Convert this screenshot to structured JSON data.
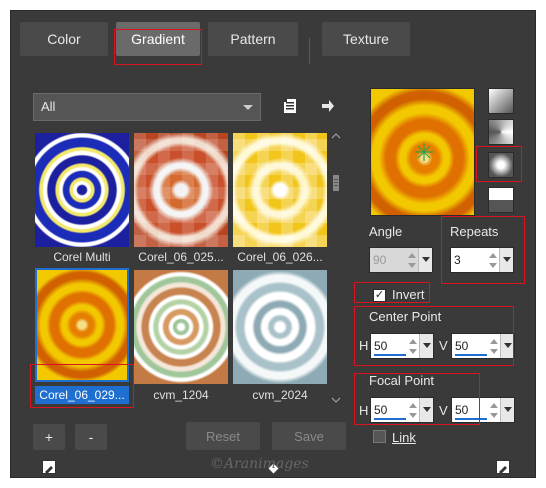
{
  "tabs": [
    {
      "label": "Color",
      "active": false
    },
    {
      "label": "Gradient",
      "active": true
    },
    {
      "label": "Pattern",
      "active": false
    },
    {
      "label": "Texture",
      "active": false
    }
  ],
  "category_dropdown": {
    "value": "All"
  },
  "thumbnails": [
    {
      "label": "Corel Multi",
      "selected": false
    },
    {
      "label": "Corel_06_025...",
      "selected": false
    },
    {
      "label": "Corel_06_026...",
      "selected": false
    },
    {
      "label": "Corel_06_029...",
      "selected": true
    },
    {
      "label": "cvm_1204",
      "selected": false
    },
    {
      "label": "cvm_2024",
      "selected": false
    }
  ],
  "buttons": {
    "add": "+",
    "remove": "-",
    "reset": "Reset",
    "save": "Save"
  },
  "angle": {
    "label": "Angle",
    "value": "90"
  },
  "repeats": {
    "label": "Repeats",
    "value": "3"
  },
  "invert": {
    "label": "Invert",
    "checked": true
  },
  "center_point": {
    "title": "Center Point",
    "h_label": "H",
    "h_value": "50",
    "v_label": "V",
    "v_value": "50"
  },
  "focal_point": {
    "title": "Focal Point",
    "h_label": "H",
    "h_value": "50",
    "v_label": "V",
    "v_value": "50"
  },
  "link": {
    "label": "Link",
    "checked": false
  },
  "watermark": "©Aranimages",
  "colors": {
    "highlight": "#d8141e",
    "selection": "#1f6fd1",
    "panel": "#3a3a3a"
  }
}
